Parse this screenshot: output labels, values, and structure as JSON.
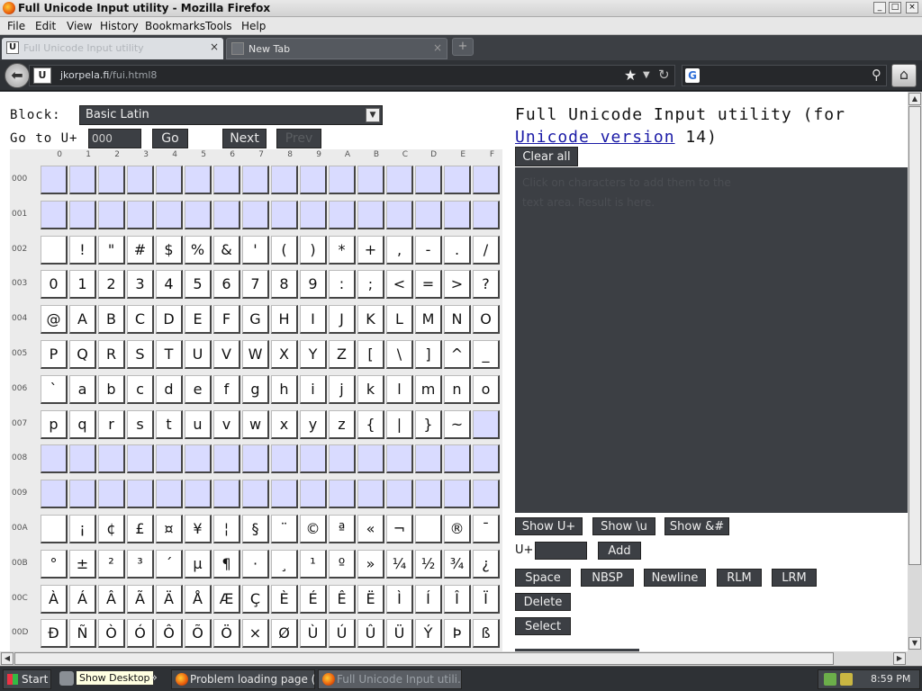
{
  "window": {
    "title": "Full Unicode Input utility - Mozilla Firefox",
    "btn_min": "_",
    "btn_max": "□",
    "btn_close": "×"
  },
  "menubar": [
    "File",
    "Edit",
    "View",
    "History",
    "Bookmarks",
    "Tools",
    "Help"
  ],
  "tabs": [
    {
      "label": "Full Unicode Input utility",
      "active": true
    },
    {
      "label": "New Tab",
      "active": false
    }
  ],
  "tab_icons": {
    "favicon": "U",
    "close": "×",
    "newtab": "+"
  },
  "navbar": {
    "back_glyph": "⬅",
    "favicon": "U",
    "url_domain": "jkorpela.fi",
    "url_path": "/fui.html8",
    "star": "★",
    "dropdown": "▼",
    "reload": "↻",
    "search_engine_glyph": "G",
    "search_placeholder": "",
    "search_glyph": "⚲",
    "home_glyph": "⌂"
  },
  "page": {
    "block_label": "Block:",
    "block_selected": "Basic Latin",
    "select_arrow": "▼",
    "goto_label": "Go to U+",
    "goto_value": "000",
    "go_button": "Go",
    "next_button": "Next",
    "prev_button": "Prev",
    "title_prefix": "Full Unicode Input utility (for",
    "title_link": "Unicode version",
    "title_suffix": "14)",
    "clear_all": "Clear all",
    "textarea_placeholder_line1": "Click on characters to add them to the",
    "textarea_placeholder_line2": "text area. Result is here.",
    "show_uplus": "Show U+",
    "show_u": "Show \\u",
    "show_amp": "Show &#",
    "uplus_label": "U+",
    "add_button": "Add",
    "space_btn": "Space",
    "nbsp_btn": "NBSP",
    "newline_btn": "Newline",
    "rlm_btn": "RLM",
    "lrm_btn": "LRM",
    "delete_btn": "Delete",
    "select_btn": "Select"
  },
  "grid": {
    "column_headers": [
      "0",
      "1",
      "2",
      "3",
      "4",
      "5",
      "6",
      "7",
      "8",
      "9",
      "A",
      "B",
      "C",
      "D",
      "E",
      "F"
    ],
    "row_headers": [
      "000",
      "001",
      "002",
      "003",
      "004",
      "005",
      "006",
      "007",
      "008",
      "009",
      "00A",
      "00B",
      "00C",
      "00D"
    ],
    "rows": [
      [
        "",
        "",
        "",
        "",
        "",
        "",
        "",
        "",
        "",
        "",
        "",
        "",
        "",
        "",
        "",
        ""
      ],
      [
        "",
        "",
        "",
        "",
        "",
        "",
        "",
        "",
        "",
        "",
        "",
        "",
        "",
        "",
        "",
        ""
      ],
      [
        " ",
        "!",
        "\"",
        "#",
        "$",
        "%",
        "&",
        "'",
        "(",
        ")",
        "*",
        "+",
        ",",
        "-",
        ".",
        "/"
      ],
      [
        "0",
        "1",
        "2",
        "3",
        "4",
        "5",
        "6",
        "7",
        "8",
        "9",
        ":",
        ";",
        "<",
        "=",
        ">",
        "?"
      ],
      [
        "@",
        "A",
        "B",
        "C",
        "D",
        "E",
        "F",
        "G",
        "H",
        "I",
        "J",
        "K",
        "L",
        "M",
        "N",
        "O"
      ],
      [
        "P",
        "Q",
        "R",
        "S",
        "T",
        "U",
        "V",
        "W",
        "X",
        "Y",
        "Z",
        "[",
        "\\",
        "]",
        "^",
        "_"
      ],
      [
        "`",
        "a",
        "b",
        "c",
        "d",
        "e",
        "f",
        "g",
        "h",
        "i",
        "j",
        "k",
        "l",
        "m",
        "n",
        "o"
      ],
      [
        "p",
        "q",
        "r",
        "s",
        "t",
        "u",
        "v",
        "w",
        "x",
        "y",
        "z",
        "{",
        "|",
        "}",
        "~",
        ""
      ],
      [
        "",
        "",
        "",
        "",
        "",
        "",
        "",
        "",
        "",
        "",
        "",
        "",
        "",
        "",
        "",
        ""
      ],
      [
        "",
        "",
        "",
        "",
        "",
        "",
        "",
        "",
        "",
        "",
        "",
        "",
        "",
        "",
        "",
        ""
      ],
      [
        " ",
        "¡",
        "¢",
        "£",
        "¤",
        "¥",
        "¦",
        "§",
        "¨",
        "©",
        "ª",
        "«",
        "¬",
        "",
        "®",
        "¯"
      ],
      [
        "°",
        "±",
        "²",
        "³",
        "´",
        "µ",
        "¶",
        "·",
        "¸",
        "¹",
        "º",
        "»",
        "¼",
        "½",
        "¾",
        "¿"
      ],
      [
        "À",
        "Á",
        "Â",
        "Ã",
        "Ä",
        "Å",
        "Æ",
        "Ç",
        "È",
        "É",
        "Ê",
        "Ë",
        "Ì",
        "Í",
        "Î",
        "Ï"
      ],
      [
        "Ð",
        "Ñ",
        "Ò",
        "Ó",
        "Ô",
        "Õ",
        "Ö",
        "×",
        "Ø",
        "Ù",
        "Ú",
        "Û",
        "Ü",
        "Ý",
        "Þ",
        "ß"
      ]
    ],
    "control_rows": [
      0,
      1,
      8,
      9
    ],
    "control_cells": [
      [
        7,
        15
      ]
    ]
  },
  "scrollbars": {
    "up": "▲",
    "down": "▼",
    "left": "◀",
    "right": "▶"
  },
  "taskbar": {
    "start": "Start",
    "tooltip": "Show Desktop",
    "overflow": "»",
    "tasks": [
      {
        "label": "Problem loading page (K-...",
        "active": false
      },
      {
        "label": "Full Unicode Input utili...",
        "active": true
      }
    ],
    "clock": "8:59 PM"
  },
  "colors": {
    "control_cell": "#d9dbff",
    "dark_ui": "#3c3f44",
    "link": "#1a1aa6"
  }
}
